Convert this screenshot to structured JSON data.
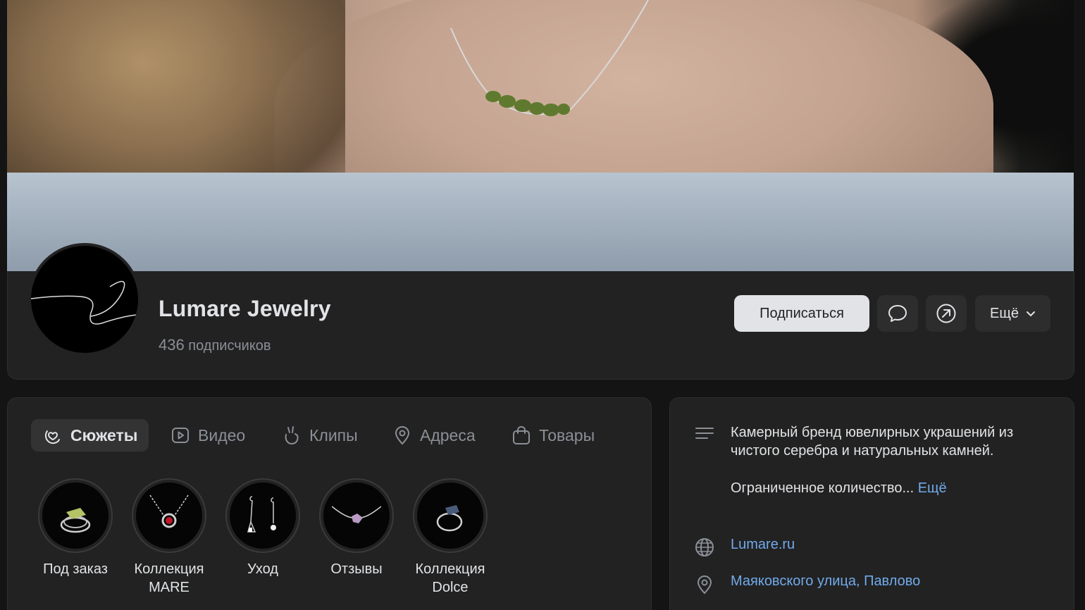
{
  "group": {
    "name": "Lumare Jewelry",
    "subscribers_count": "436",
    "subscribers_label": "подписчиков"
  },
  "actions": {
    "subscribe_label": "Подписаться",
    "more_label": "Ещё"
  },
  "tabs": [
    {
      "label": "Сюжеты",
      "icon": "stories-icon",
      "active": true
    },
    {
      "label": "Видео",
      "icon": "video-icon",
      "active": false
    },
    {
      "label": "Клипы",
      "icon": "clips-icon",
      "active": false
    },
    {
      "label": "Адреса",
      "icon": "location-icon",
      "active": false
    },
    {
      "label": "Товары",
      "icon": "bag-icon",
      "active": false
    }
  ],
  "stories": [
    {
      "line1": "Под заказ",
      "line2": ""
    },
    {
      "line1": "Коллекция",
      "line2": "MARE"
    },
    {
      "line1": "Уход",
      "line2": ""
    },
    {
      "line1": "Отзывы",
      "line2": ""
    },
    {
      "line1": "Коллекция",
      "line2": "Dolce"
    }
  ],
  "info": {
    "description_p1": "Камерный бренд ювелирных украшений из чистого серебра и натуральных камней.",
    "description_p2": "Ограниченное количество...",
    "more_link": "Ещё",
    "website": "Lumare.ru",
    "address": "Маяковского улица, Павлово"
  },
  "colors": {
    "background": "#141414",
    "card": "#222222",
    "link": "#71aaeb",
    "text_primary": "#e1e3e6",
    "text_secondary": "#8b8f96"
  }
}
